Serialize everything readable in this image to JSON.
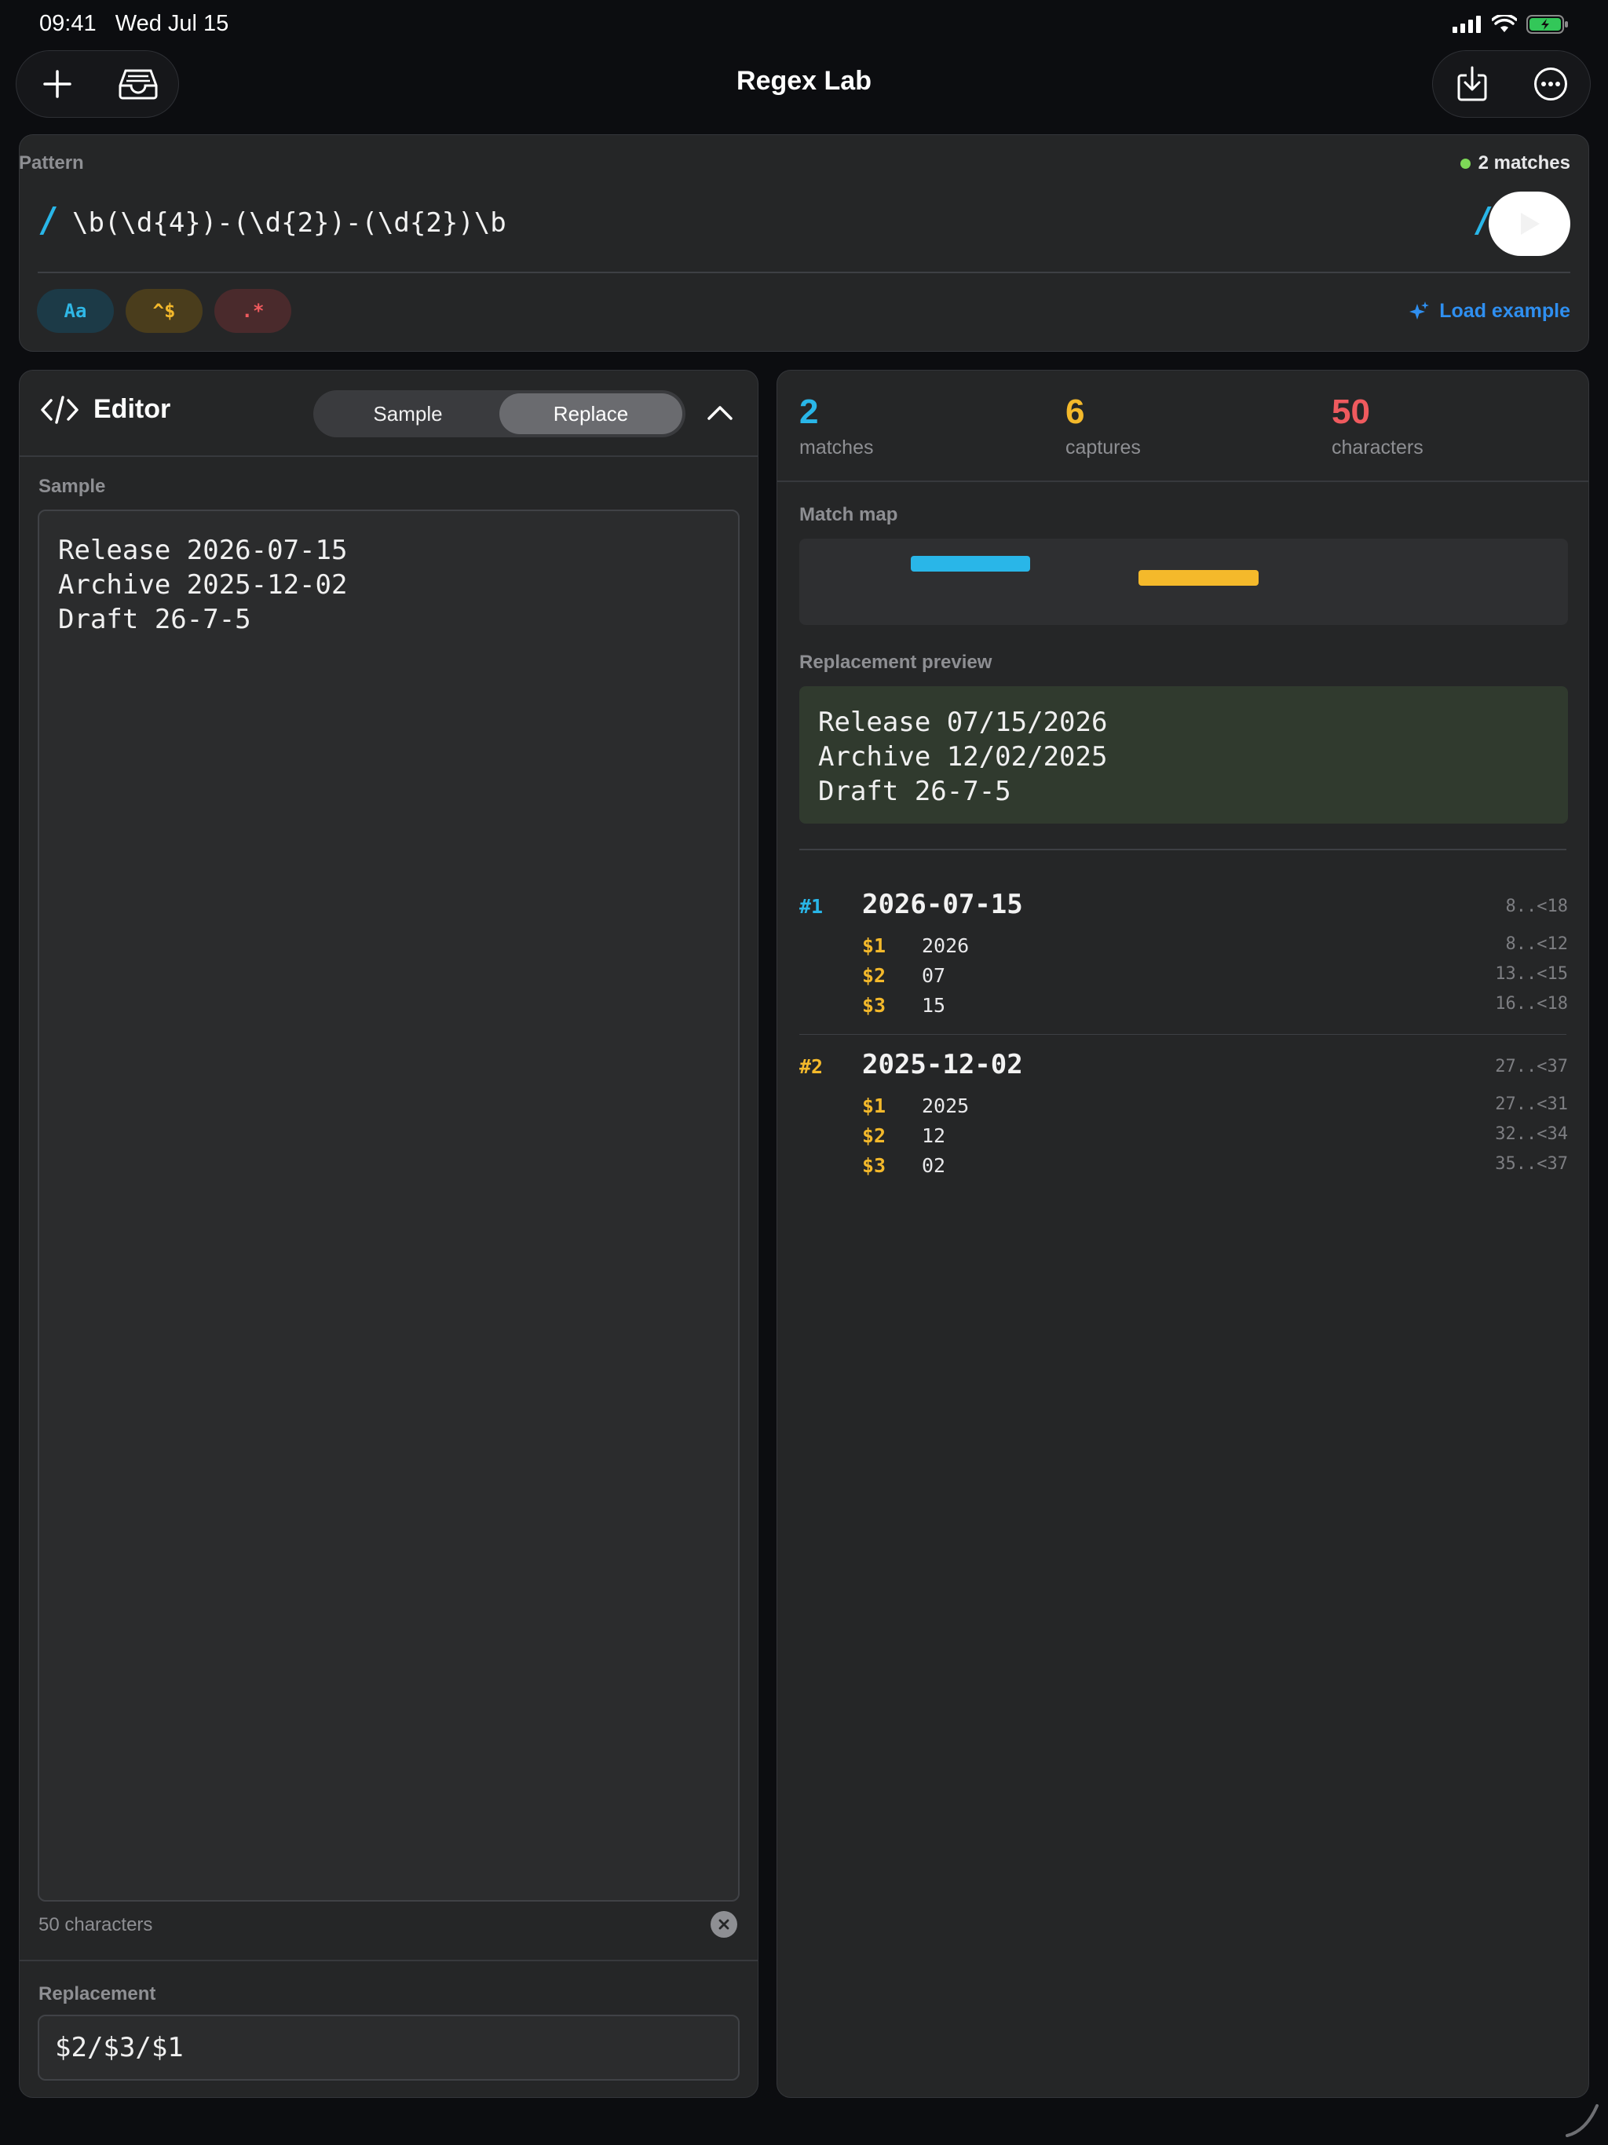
{
  "status_bar": {
    "time": "09:41",
    "date": "Wed Jul 15"
  },
  "nav": {
    "title": "Regex Lab"
  },
  "pattern": {
    "label": "Pattern",
    "match_status": "2 matches",
    "expression": "\\b(\\d{4})-(\\d{2})-(\\d{2})\\b",
    "flags": [
      "Aa",
      "^$",
      ".*"
    ],
    "load_example": "Load example"
  },
  "editor": {
    "title": "Editor",
    "segments": [
      "Sample",
      "Replace"
    ],
    "active_segment": "Replace",
    "sample_label": "Sample",
    "sample_lines": [
      "Release 2026-07-15",
      "Archive 2025-12-02",
      "Draft 26-7-5"
    ],
    "char_count": "50 characters",
    "replacement_label": "Replacement",
    "replacement_value": "$2/$3/$1"
  },
  "results": {
    "stats": [
      {
        "value": "2",
        "label": "matches",
        "color": "#29b6e8"
      },
      {
        "value": "6",
        "label": "captures",
        "color": "#f4b92b"
      },
      {
        "value": "50",
        "label": "characters",
        "color": "#ef5a5e"
      }
    ],
    "match_map_label": "Match map",
    "match_map": {
      "total_chars": 50,
      "spans": [
        {
          "start": 8,
          "end": 18,
          "color": "#29b6e8"
        },
        {
          "start": 27,
          "end": 37,
          "color": "#f4b92b"
        }
      ]
    },
    "preview_label": "Replacement preview",
    "preview_lines": [
      "Release 07/15/2026",
      "Archive 12/02/2025",
      "Draft 26-7-5"
    ],
    "matches": [
      {
        "index": "#1",
        "color": "#29b6e8",
        "text": "2026-07-15",
        "range": "8..<18",
        "groups": [
          {
            "name": "$1",
            "value": "2026",
            "range": "8..<12"
          },
          {
            "name": "$2",
            "value": "07",
            "range": "13..<15"
          },
          {
            "name": "$3",
            "value": "15",
            "range": "16..<18"
          }
        ]
      },
      {
        "index": "#2",
        "color": "#f4b92b",
        "text": "2025-12-02",
        "range": "27..<37",
        "groups": [
          {
            "name": "$1",
            "value": "2025",
            "range": "27..<31"
          },
          {
            "name": "$2",
            "value": "12",
            "range": "32..<34"
          },
          {
            "name": "$3",
            "value": "02",
            "range": "35..<37"
          }
        ]
      }
    ]
  }
}
